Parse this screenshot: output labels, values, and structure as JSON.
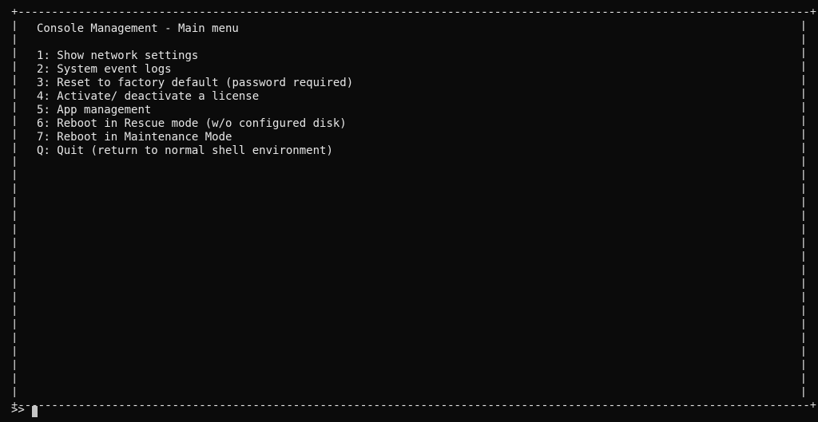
{
  "ui": {
    "title": "Console Management - Main menu",
    "blank": "",
    "menu": [
      {
        "key": "1",
        "label": "Show network settings"
      },
      {
        "key": "2",
        "label": "System event logs"
      },
      {
        "key": "3",
        "label": "Reset to factory default (password required)"
      },
      {
        "key": "4",
        "label": "Activate/ deactivate a license"
      },
      {
        "key": "5",
        "label": "App management"
      },
      {
        "key": "6",
        "label": "Reboot in Rescue mode (w/o configured disk)"
      },
      {
        "key": "7",
        "label": "Reboot in Maintenance Mode"
      },
      {
        "key": "Q",
        "label": "Quit (return to normal shell environment)"
      }
    ],
    "prompt": ">>",
    "input_value": ""
  },
  "box": {
    "corner": "+",
    "hchar": "-",
    "vchar": "|",
    "inner_width": 118,
    "inner_lines": 28
  }
}
